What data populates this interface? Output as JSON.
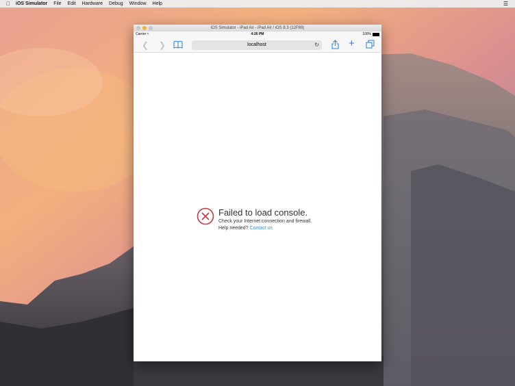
{
  "menubar": {
    "apple_icon": "apple-icon",
    "app_name": "iOS Simulator",
    "menus": [
      "File",
      "Edit",
      "Hardware",
      "Debug",
      "Window",
      "Help"
    ],
    "right_icon": "list-icon"
  },
  "window": {
    "title": "iOS Simulator - iPad Air - iPad Air / iOS 8.3 (12F69)"
  },
  "statusbar": {
    "carrier": "Carrier",
    "time": "4:26 PM",
    "battery": "100%"
  },
  "navbar": {
    "address": "localhost"
  },
  "error": {
    "title": "Failed to load console.",
    "line1": "Check your Internet connection and firewall.",
    "help_prefix": "Help needed? ",
    "contact_link": "Contact us"
  },
  "colors": {
    "accent": "#1e7bf6",
    "error_red": "#c8383e",
    "link": "#3a8fd6"
  }
}
